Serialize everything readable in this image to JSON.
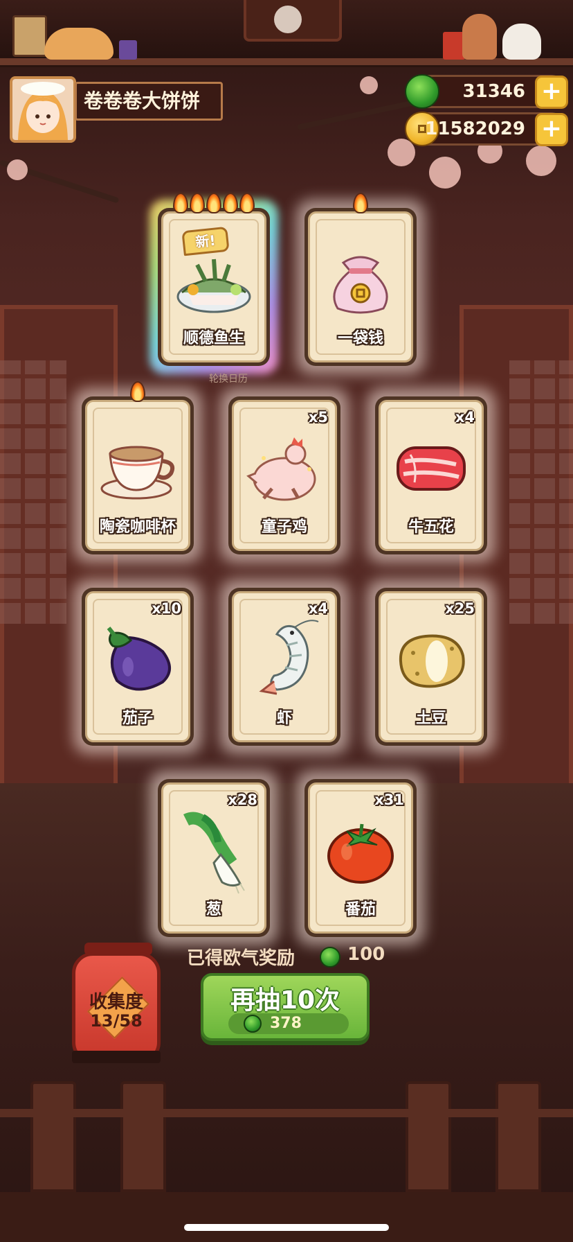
{
  "player": {
    "name": "卷卷卷大饼饼"
  },
  "currency": {
    "jade": {
      "value": "31346",
      "icon": "jade-coin-icon"
    },
    "gold": {
      "value": "11582029",
      "icon": "gold-coin-icon"
    }
  },
  "background": {
    "calendar_label": "轮换日历"
  },
  "cards": [
    {
      "name": "顺德鱼生",
      "count": "",
      "flames": 5,
      "is_new": true,
      "new_label": "新!",
      "rarity": "legendary",
      "icon": "fish-sashimi-icon"
    },
    {
      "name": "一袋钱",
      "count": "",
      "flames": 1,
      "is_new": false,
      "rarity": "rare",
      "icon": "money-bag-icon"
    },
    {
      "name": "陶瓷咖啡杯",
      "count": "",
      "flames": 1,
      "is_new": false,
      "rarity": "rare",
      "icon": "coffee-cup-icon"
    },
    {
      "name": "童子鸡",
      "count": "x5",
      "flames": 0,
      "is_new": false,
      "rarity": "common",
      "icon": "chicken-icon"
    },
    {
      "name": "牛五花",
      "count": "x4",
      "flames": 0,
      "is_new": false,
      "rarity": "common",
      "icon": "beef-icon"
    },
    {
      "name": "茄子",
      "count": "x10",
      "flames": 0,
      "is_new": false,
      "rarity": "common",
      "icon": "eggplant-icon"
    },
    {
      "name": "虾",
      "count": "x4",
      "flames": 0,
      "is_new": false,
      "rarity": "common",
      "icon": "shrimp-icon"
    },
    {
      "name": "土豆",
      "count": "x25",
      "flames": 0,
      "is_new": false,
      "rarity": "common",
      "icon": "potato-icon"
    },
    {
      "name": "葱",
      "count": "x28",
      "flames": 0,
      "is_new": false,
      "rarity": "common",
      "icon": "scallion-icon"
    },
    {
      "name": "番茄",
      "count": "x31",
      "flames": 0,
      "is_new": false,
      "rarity": "common",
      "icon": "tomato-icon"
    }
  ],
  "collection": {
    "label": "收集度",
    "progress": "13/58"
  },
  "lucky_reward": {
    "label": "已得欧气奖励",
    "value": "100"
  },
  "draw_button": {
    "label": "再抽10次",
    "cost": "378"
  },
  "colors": {
    "accent_green": "#69b53a",
    "gold": "#f6c53a",
    "card_bg": "#f5e6c8"
  }
}
